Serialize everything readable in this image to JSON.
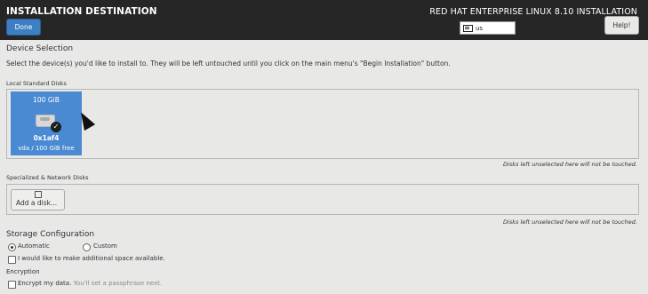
{
  "header": {
    "title": "INSTALLATION DESTINATION",
    "done_label": "Done",
    "product": "RED HAT ENTERPRISE LINUX 8.10 INSTALLATION",
    "keyboard_layout": "us",
    "help_label": "Help!"
  },
  "device_selection": {
    "heading": "Device Selection",
    "description": "Select the device(s) you'd like to install to.  They will be left untouched until you click on the main menu's \"Begin Installation\" button."
  },
  "local_disks": {
    "label": "Local Standard Disks",
    "disks": [
      {
        "size": "100 GiB",
        "name": "0x1af4",
        "info": "vda  /  100 GiB free",
        "selected": true
      }
    ],
    "note": "Disks left unselected here will not be touched."
  },
  "network_disks": {
    "label": "Specialized & Network Disks",
    "add_label": "Add a disk...",
    "note": "Disks left unselected here will not be touched."
  },
  "storage": {
    "heading": "Storage Configuration",
    "automatic_label": "Automatic",
    "custom_label": "Custom",
    "selected": "Automatic",
    "extra_space_label": "I would like to make additional space available."
  },
  "encryption": {
    "heading": "Encryption",
    "encrypt_label": "Encrypt my data.",
    "encrypt_hint": "You'll set a passphrase next."
  },
  "colors": {
    "header_bg": "#262626",
    "accent": "#3c7fc2",
    "disk_selected": "#4a8ad2"
  },
  "icons": [
    "keyboard-icon",
    "hard-disk-icon",
    "checkmark-icon",
    "add-disk-icon",
    "mouse-cursor-icon"
  ]
}
